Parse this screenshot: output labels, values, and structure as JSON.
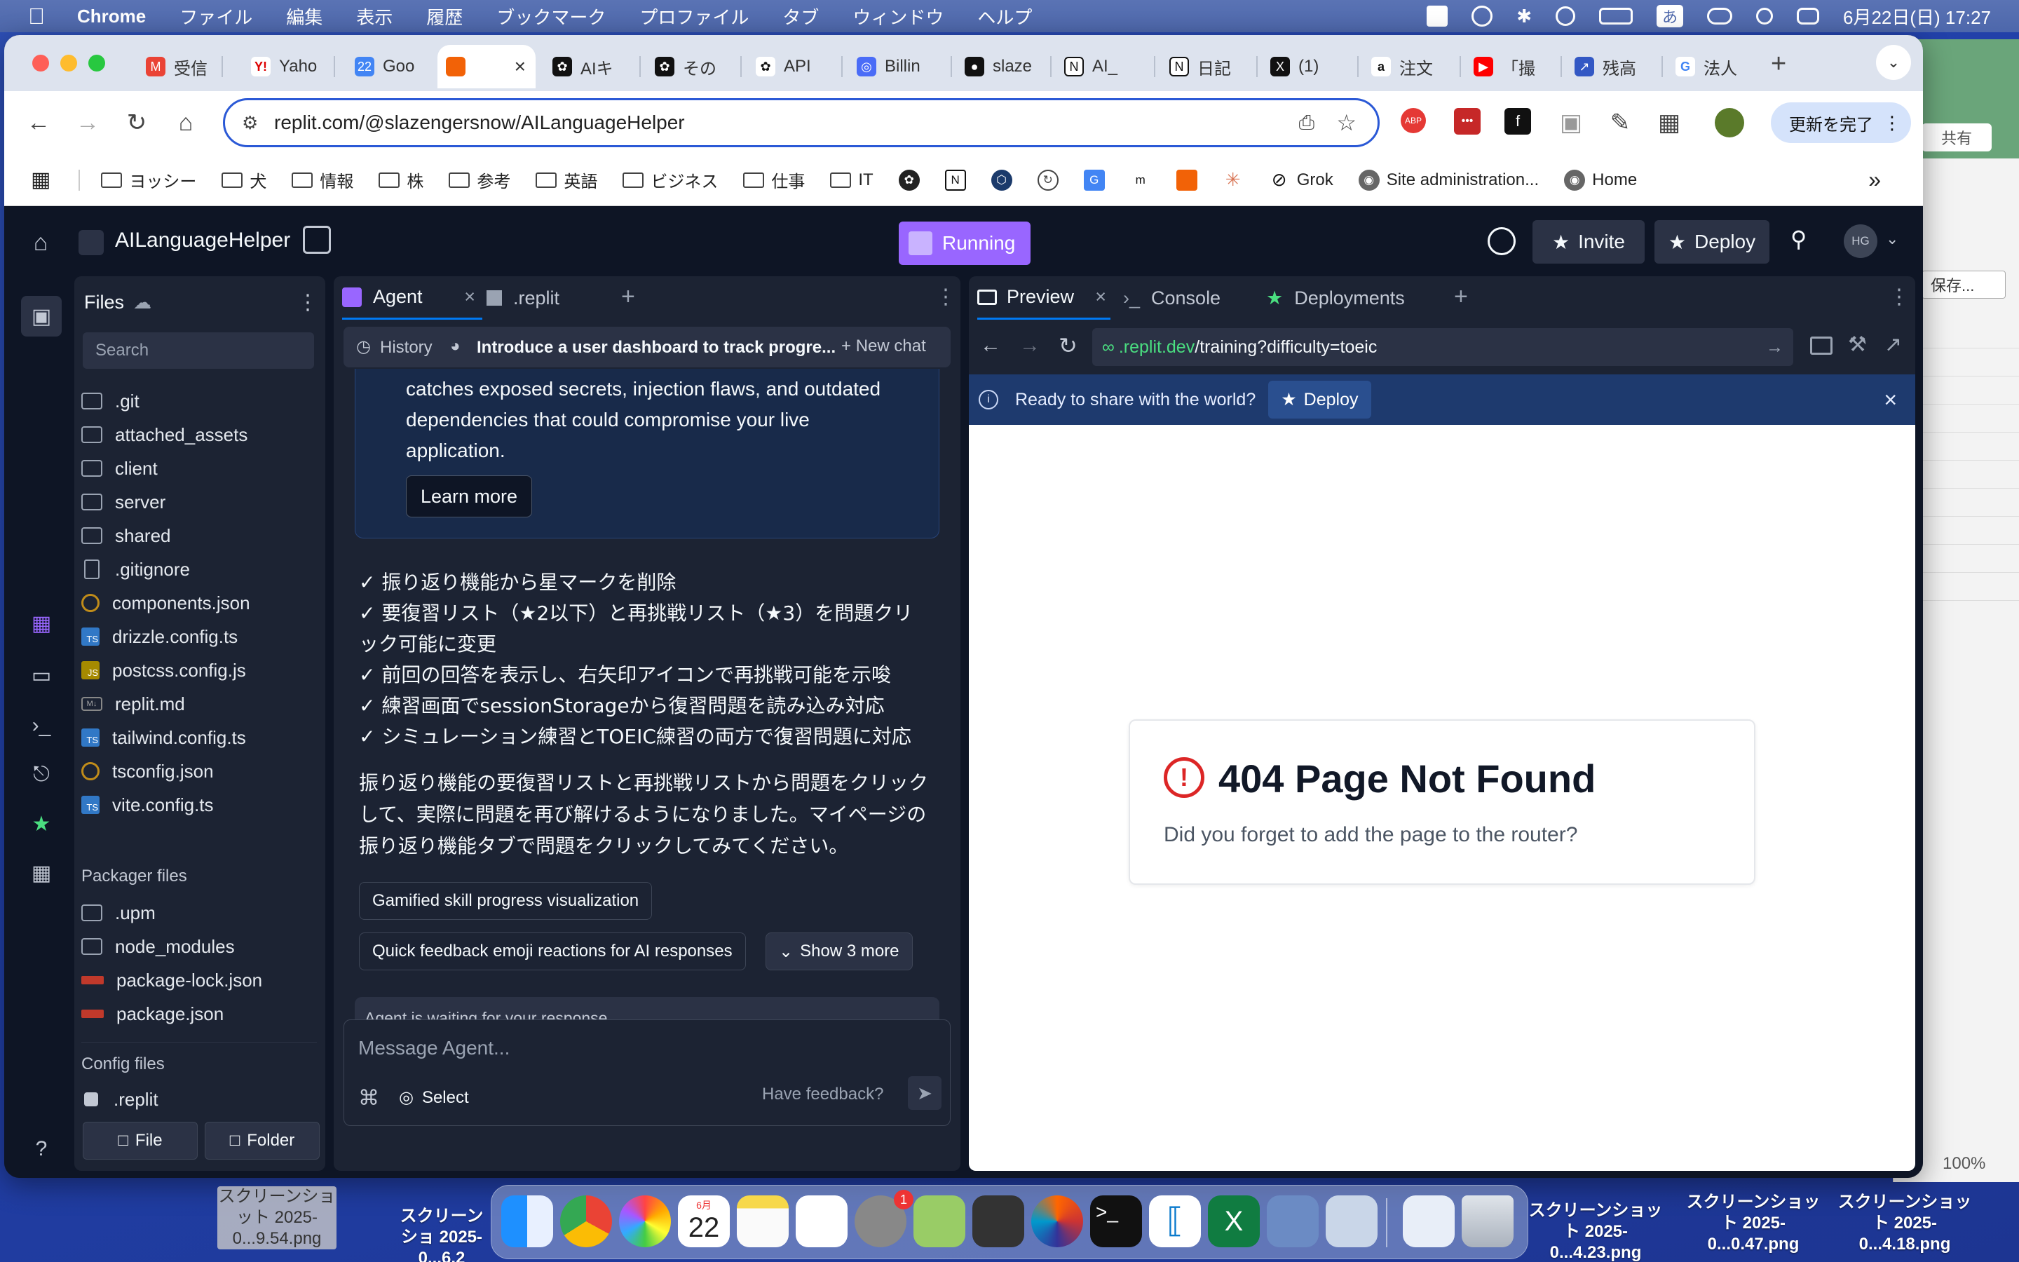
{
  "menubar": {
    "app": "Chrome",
    "items": [
      "ファイル",
      "編集",
      "表示",
      "履歴",
      "ブックマーク",
      "プロファイル",
      "タブ",
      "ウィンドウ",
      "ヘルプ"
    ],
    "datetime": "6月22日(日) 17:27",
    "input_mode": "あ"
  },
  "browser": {
    "tabs": [
      "受信",
      "Yaho",
      "Goo",
      "",
      "AIキ",
      "その",
      "API",
      "Billin",
      "slaze",
      "AI_",
      "日記",
      "(1) ",
      "注文",
      "「撮",
      "残高",
      "法人"
    ],
    "url": "replit.com/@slazengersnow/AILanguageHelper",
    "update_button": "更新を完了",
    "bookmarks": [
      "ヨッシー",
      "犬",
      "情報",
      "株",
      "参考",
      "英語",
      "ビジネス",
      "仕事",
      "IT"
    ],
    "bookmarks_right": [
      "Grok",
      "Site administration...",
      "Home"
    ]
  },
  "ide": {
    "project_name": "AILanguageHelper",
    "run_label": "Running",
    "invite": "Invite",
    "deploy": "Deploy",
    "avatar": "HG",
    "files": {
      "title": "Files",
      "search_placeholder": "Search",
      "items": [
        ".git",
        "attached_assets",
        "client",
        "server",
        "shared",
        ".gitignore",
        "components.json",
        "drizzle.config.ts",
        "postcss.config.js",
        "replit.md",
        "tailwind.config.ts",
        "tsconfig.json",
        "vite.config.ts"
      ],
      "packager_title": "Packager files",
      "packager_items": [
        ".upm",
        "node_modules",
        "package-lock.json",
        "package.json"
      ],
      "config_title": "Config files",
      "config_items": [
        ".replit"
      ],
      "file_btn": "File",
      "folder_btn": "Folder"
    },
    "agent": {
      "tab": "Agent",
      "tab2": ".replit",
      "history": "History",
      "chat_title": "Introduce a user dashboard to track progre...",
      "new_chat": "New chat",
      "security_lines": [
        "catches exposed secrets, injection flaws, and outdated",
        "dependencies that could compromise your live",
        "application."
      ],
      "learn_more": "Learn more",
      "checks": [
        "✓ 振り返り機能から星マークを削除",
        "✓ 要復習リスト（★2以下）と再挑戦リスト（★3）を問題クリ",
        "ック可能に変更",
        "✓ 前回の回答を表示し、右矢印アイコンで再挑戦可能を示唆",
        "✓ 練習画面でsessionStorageから復習問題を読み込み対応",
        "✓ シミュレーション練習とTOEIC練習の両方で復習問題に対応"
      ],
      "summary": [
        "振り返り機能の要復習リストと再挑戦リストから問題をクリック",
        "して、実際に問題を再び解けるようになりました。マイページの",
        "振り返り機能タブで問題をクリックしてみてください。"
      ],
      "suggestion1": "Gamified skill progress visualization",
      "suggestion2": "Quick feedback emoji reactions for AI responses",
      "show_more": "Show 3 more",
      "waiting": "Agent is waiting for your response",
      "input_placeholder": "Message Agent...",
      "select": "Select",
      "feedback": "Have feedback?"
    },
    "preview": {
      "tabs": [
        "Preview",
        "Console",
        "Deployments"
      ],
      "url_domain": ".replit.dev",
      "url_path": "/training?difficulty=toeic",
      "banner_text": "Ready to share with the world?",
      "banner_btn": "Deploy",
      "error_title": "404 Page Not Found",
      "error_msg": "Did you forget to add the page to the router?"
    }
  },
  "background_app": {
    "share": "共有",
    "save": "保存...",
    "zoom": "100%"
  },
  "desktop_files": [
    "スクリーンショット 2025-0...9.54.png",
    "スクリーンショ 2025-0...6.2",
    "スクリーンショット 2025-0...4.23.png",
    "スクリーンショット 2025-0...0.47.png",
    "スクリーンショット 2025-0...4.18.png"
  ],
  "dock": {
    "calendar_month": "6月",
    "calendar_day": "22",
    "badge": "1"
  },
  "colors": {
    "accent": "#9966ff",
    "ide_bg": "#0e1525",
    "panel_bg": "#1c2333",
    "banner": "#1e3a6e",
    "error": "#dc2626"
  }
}
